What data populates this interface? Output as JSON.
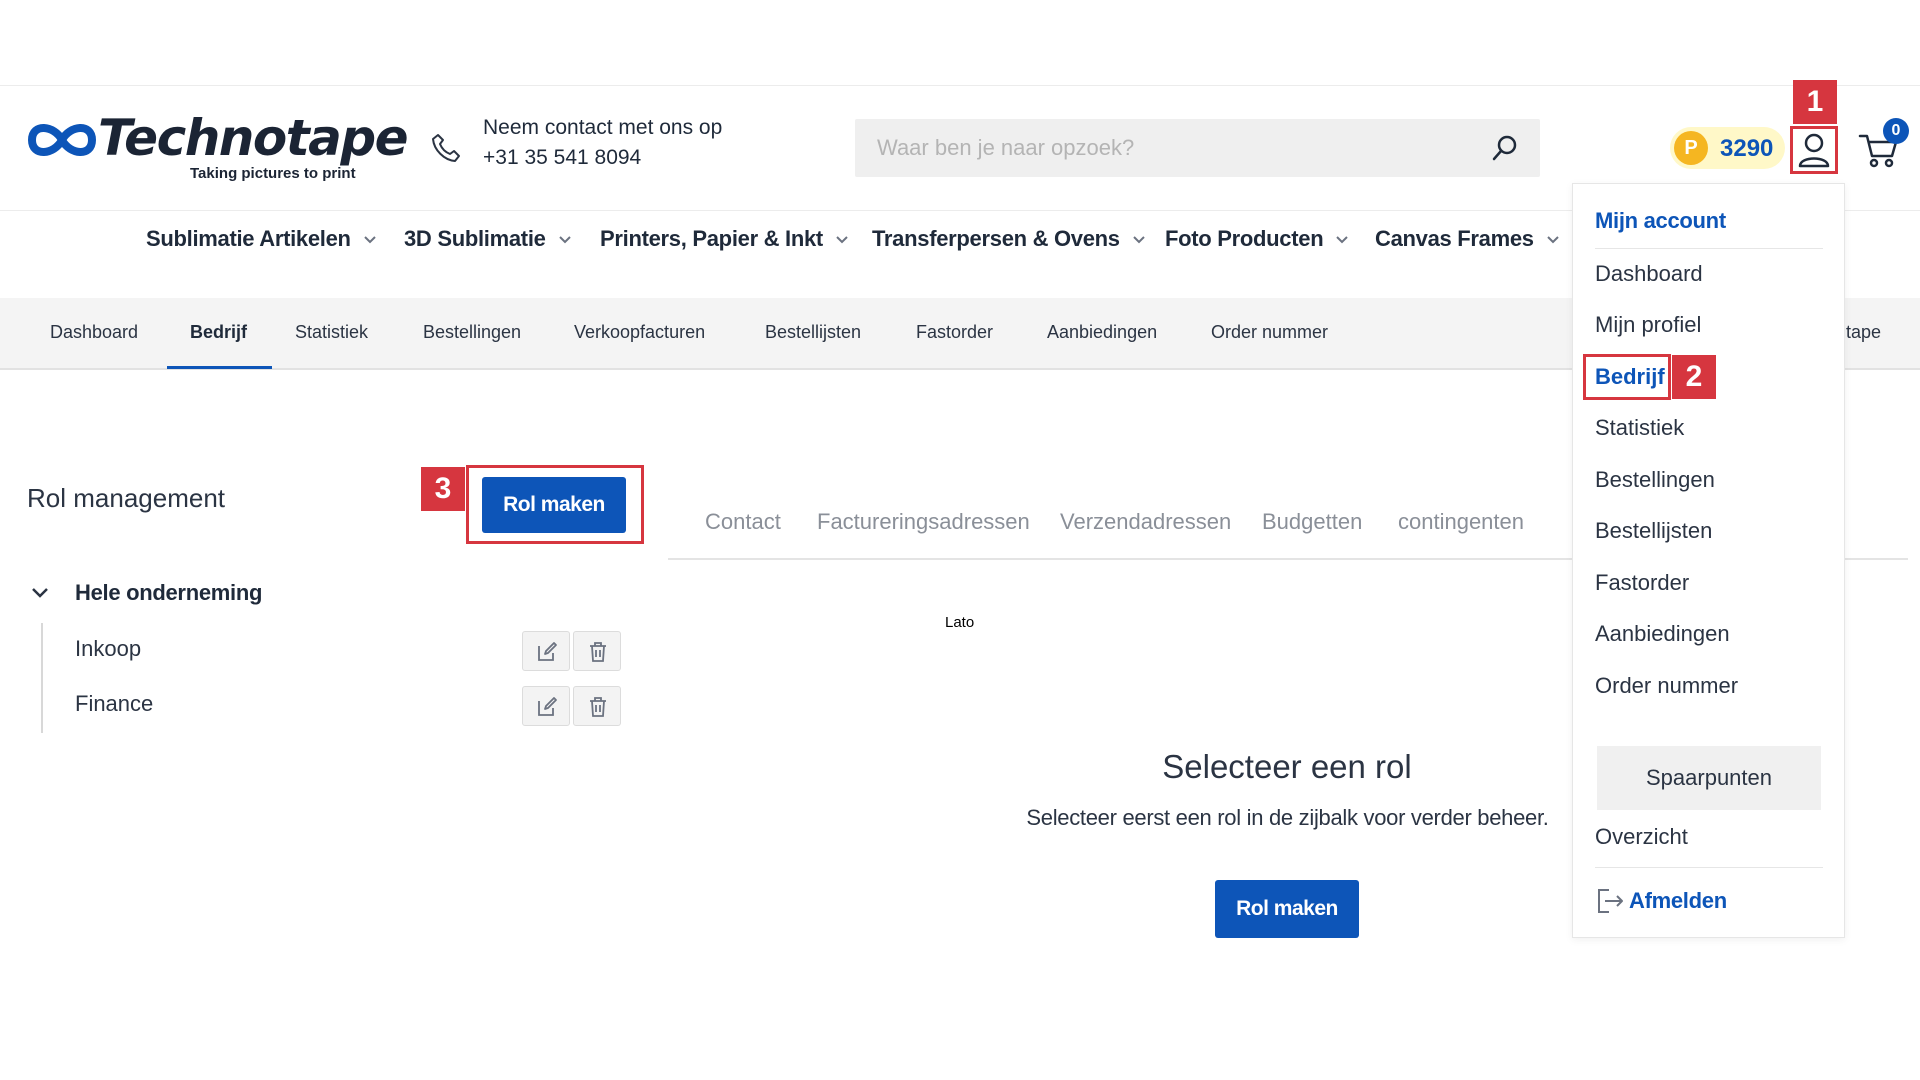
{
  "header": {
    "logo_text": "Technotape",
    "logo_tagline": "Taking pictures to print",
    "contact_line1": "Neem contact met ons op",
    "contact_line2": "+31 35 541 8094",
    "search_placeholder": "Waar ben je naar opzoek?",
    "points_letter": "P",
    "points_value": "3290",
    "cart_count": "0"
  },
  "main_nav": [
    {
      "label": "Sublimatie Artikelen"
    },
    {
      "label": "3D Sublimatie"
    },
    {
      "label": "Printers, Papier & Inkt"
    },
    {
      "label": "Transferpersen & Ovens"
    },
    {
      "label": "Foto Producten"
    },
    {
      "label": "Canvas Frames"
    }
  ],
  "sub_nav": {
    "items": [
      "Dashboard",
      "Bedrijf",
      "Statistiek",
      "Bestellingen",
      "Verkoopfacturen",
      "Bestellijsten",
      "Fastorder",
      "Aanbiedingen",
      "Order nummer"
    ],
    "active": "Bedrijf",
    "overflow_text": "tape"
  },
  "roles": {
    "title": "Rol management",
    "create_button": "Rol maken",
    "group_label": "Hele onderneming",
    "items": [
      "Inkoop",
      "Finance"
    ]
  },
  "tabs": [
    "Contact",
    "Factureringsadressen",
    "Verzendadressen",
    "Budgetten",
    "contingenten"
  ],
  "stray_text": "Lato",
  "empty_state": {
    "title": "Selecteer een rol",
    "subtitle": "Selecteer eerst een rol in de zijbalk voor verder beheer.",
    "button": "Rol maken"
  },
  "account_menu": {
    "heading": "Mijn account",
    "items": [
      "Dashboard",
      "Mijn profiel",
      "Bedrijf",
      "Statistiek",
      "Bestellingen",
      "Bestellijsten",
      "Fastorder",
      "Aanbiedingen",
      "Order nummer"
    ],
    "active": "Bedrijf",
    "spaarpunten_label": "Spaarpunten",
    "overzicht_label": "Overzicht",
    "logout_label": "Afmelden"
  },
  "callouts": [
    "1",
    "2",
    "3"
  ],
  "colors": {
    "brand_blue": "#0d55b8",
    "callout_red": "#d6363f",
    "points_gold": "#f5b621"
  }
}
